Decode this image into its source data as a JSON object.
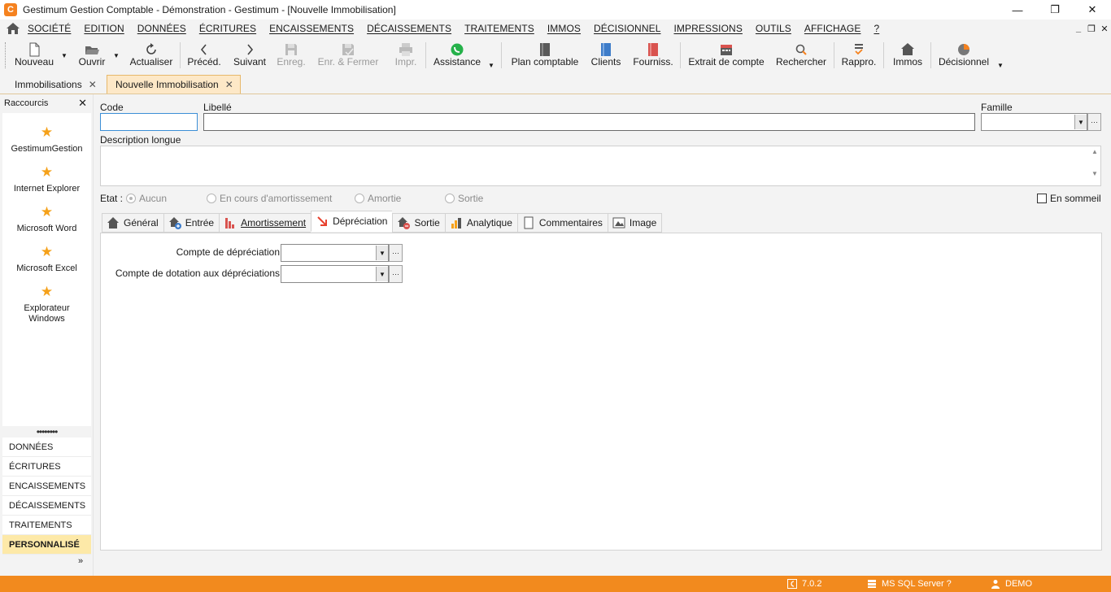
{
  "window": {
    "title": "Gestimum Gestion Comptable - Démonstration - Gestimum - [Nouvelle Immobilisation]",
    "logo_letter": "C",
    "controls": {
      "minimize": "—",
      "maximize": "❐",
      "close": "✕"
    }
  },
  "menu": {
    "items": [
      "SOCIÉTÉ",
      "EDITION",
      "DONNÉES",
      "ÉCRITURES",
      "ENCAISSEMENTS",
      "DÉCAISSEMENTS",
      "TRAITEMENTS",
      "IMMOS",
      "DÉCISIONNEL",
      "IMPRESSIONS",
      "OUTILS",
      "AFFICHAGE",
      "?"
    ],
    "mdi_controls": {
      "minimize": "_",
      "restore": "❐",
      "close": "✕"
    }
  },
  "toolbar": {
    "nouveau": "Nouveau",
    "ouvrir": "Ouvrir",
    "actualiser": "Actualiser",
    "preced": "Précéd.",
    "suivant": "Suivant",
    "enreg": "Enreg.",
    "enr_fermer": "Enr. & Fermer",
    "impr": "Impr.",
    "assistance": "Assistance",
    "plan_comptable": "Plan comptable",
    "clients": "Clients",
    "fourniss": "Fourniss.",
    "extrait": "Extrait de compte",
    "rechercher": "Rechercher",
    "rappro": "Rappro.",
    "immos": "Immos",
    "decisionnel": "Décisionnel"
  },
  "doc_tabs": [
    {
      "label": "Immobilisations",
      "active": false
    },
    {
      "label": "Nouvelle Immobilisation",
      "active": true
    }
  ],
  "sidebar": {
    "header": "Raccourcis",
    "shortcuts": [
      "GestimumGestion",
      "Internet Explorer",
      "Microsoft Word",
      "Microsoft Excel",
      "Explorateur Windows"
    ],
    "nav": [
      "DONNÉES",
      "ÉCRITURES",
      "ENCAISSEMENTS",
      "DÉCAISSEMENTS",
      "TRAITEMENTS",
      "PERSONNALISÉ"
    ],
    "active_nav": "PERSONNALISÉ",
    "more": "»"
  },
  "form": {
    "code_label": "Code",
    "code_value": "",
    "libelle_label": "Libellé",
    "libelle_value": "",
    "famille_label": "Famille",
    "famille_value": "",
    "description_label": "Description longue",
    "description_value": "",
    "etat_label": "Etat :",
    "etat_options": [
      "Aucun",
      "En cours d'amortissement",
      "Amortie",
      "Sortie"
    ],
    "etat_selected": "Aucun",
    "sommeil_label": "En sommeil",
    "sommeil_checked": false
  },
  "tabs": [
    {
      "label": "Général",
      "active": false
    },
    {
      "label": "Entrée",
      "active": false
    },
    {
      "label": "Amortissement",
      "active": false
    },
    {
      "label": "Dépréciation",
      "active": true
    },
    {
      "label": "Sortie",
      "active": false
    },
    {
      "label": "Analytique",
      "active": false
    },
    {
      "label": "Commentaires",
      "active": false
    },
    {
      "label": "Image",
      "active": false
    }
  ],
  "depreciation": {
    "compte_depreciation_label": "Compte de dépréciation",
    "compte_depreciation_value": "",
    "compte_dotation_label": "Compte de dotation aux dépréciations",
    "compte_dotation_value": "",
    "ellipsis": "···"
  },
  "status": {
    "version": "7.0.2",
    "db": "MS SQL Server ?",
    "user": "DEMO"
  },
  "colors": {
    "accent": "#f28a1e",
    "active_tab_bg": "#fde8c7",
    "active_nav_bg": "#fde9a8",
    "star": "#f5a11a"
  }
}
